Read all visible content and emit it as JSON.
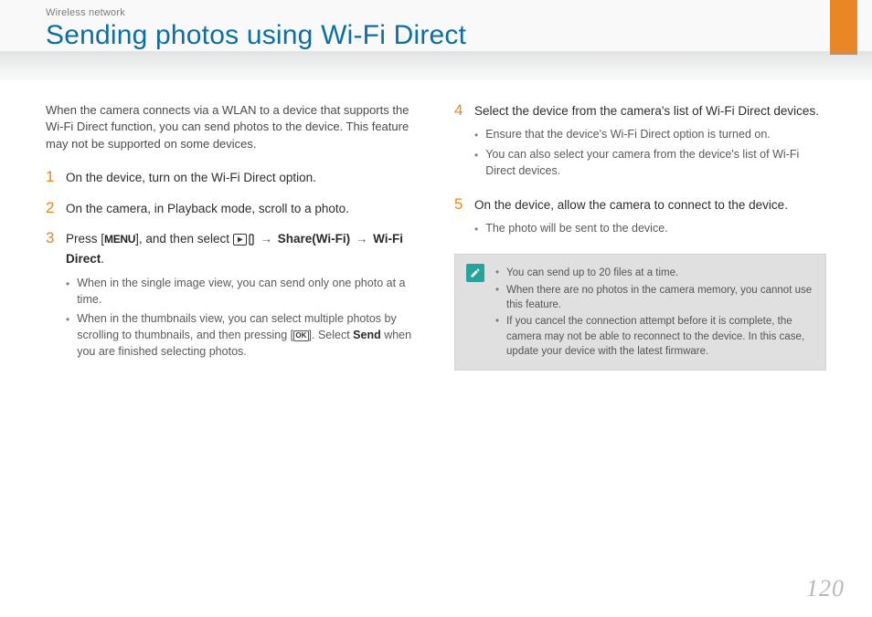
{
  "header": {
    "section": "Wireless network",
    "title": "Sending photos using Wi-Fi Direct"
  },
  "intro": "When the camera connects via a WLAN to a device that supports the Wi-Fi Direct function, you can send photos to the device. This feature may not be supported on some devices.",
  "steps_left": [
    {
      "n": "1",
      "head": "On the device, turn on the Wi-Fi Direct option.",
      "bullets": []
    },
    {
      "n": "2",
      "head": "On the camera, in Playback mode, scroll to a photo.",
      "bullets": []
    },
    {
      "n": "3",
      "head_parts": {
        "p1": "Press [",
        "menu": "MENU",
        "p2": "], and then select ",
        "arrow1": " → ",
        "share": "Share(Wi-Fi)",
        "arrow2": " → ",
        "wifidirect": "Wi-Fi Direct",
        "dot": "."
      },
      "bullets": [
        "When in the single image view, you can send only one photo at a time.",
        "When in the thumbnails view, you can select multiple photos by scrolling to thumbnails, and then pressing [OK]. Select Send when you are finished selecting photos."
      ]
    }
  ],
  "steps_right": [
    {
      "n": "4",
      "head": "Select the device from the camera's list of Wi-Fi Direct devices.",
      "bullets": [
        "Ensure that the device's Wi-Fi Direct option is turned on.",
        "You can also select your camera from the device's list of Wi-Fi Direct devices."
      ]
    },
    {
      "n": "5",
      "head": "On the device, allow the camera to connect to the device.",
      "bullets": [
        "The photo will be sent to the device."
      ]
    }
  ],
  "note": [
    "You can send up to 20 files at a time.",
    "When there are no photos in the camera memory, you cannot use this feature.",
    "If you cancel the connection attempt before it is complete, the camera may not be able to reconnect to the device. In this case, update your device with the latest firmware."
  ],
  "icons": {
    "ok_key": "OK",
    "play_info": "play-info-icon"
  },
  "page_number": "120"
}
